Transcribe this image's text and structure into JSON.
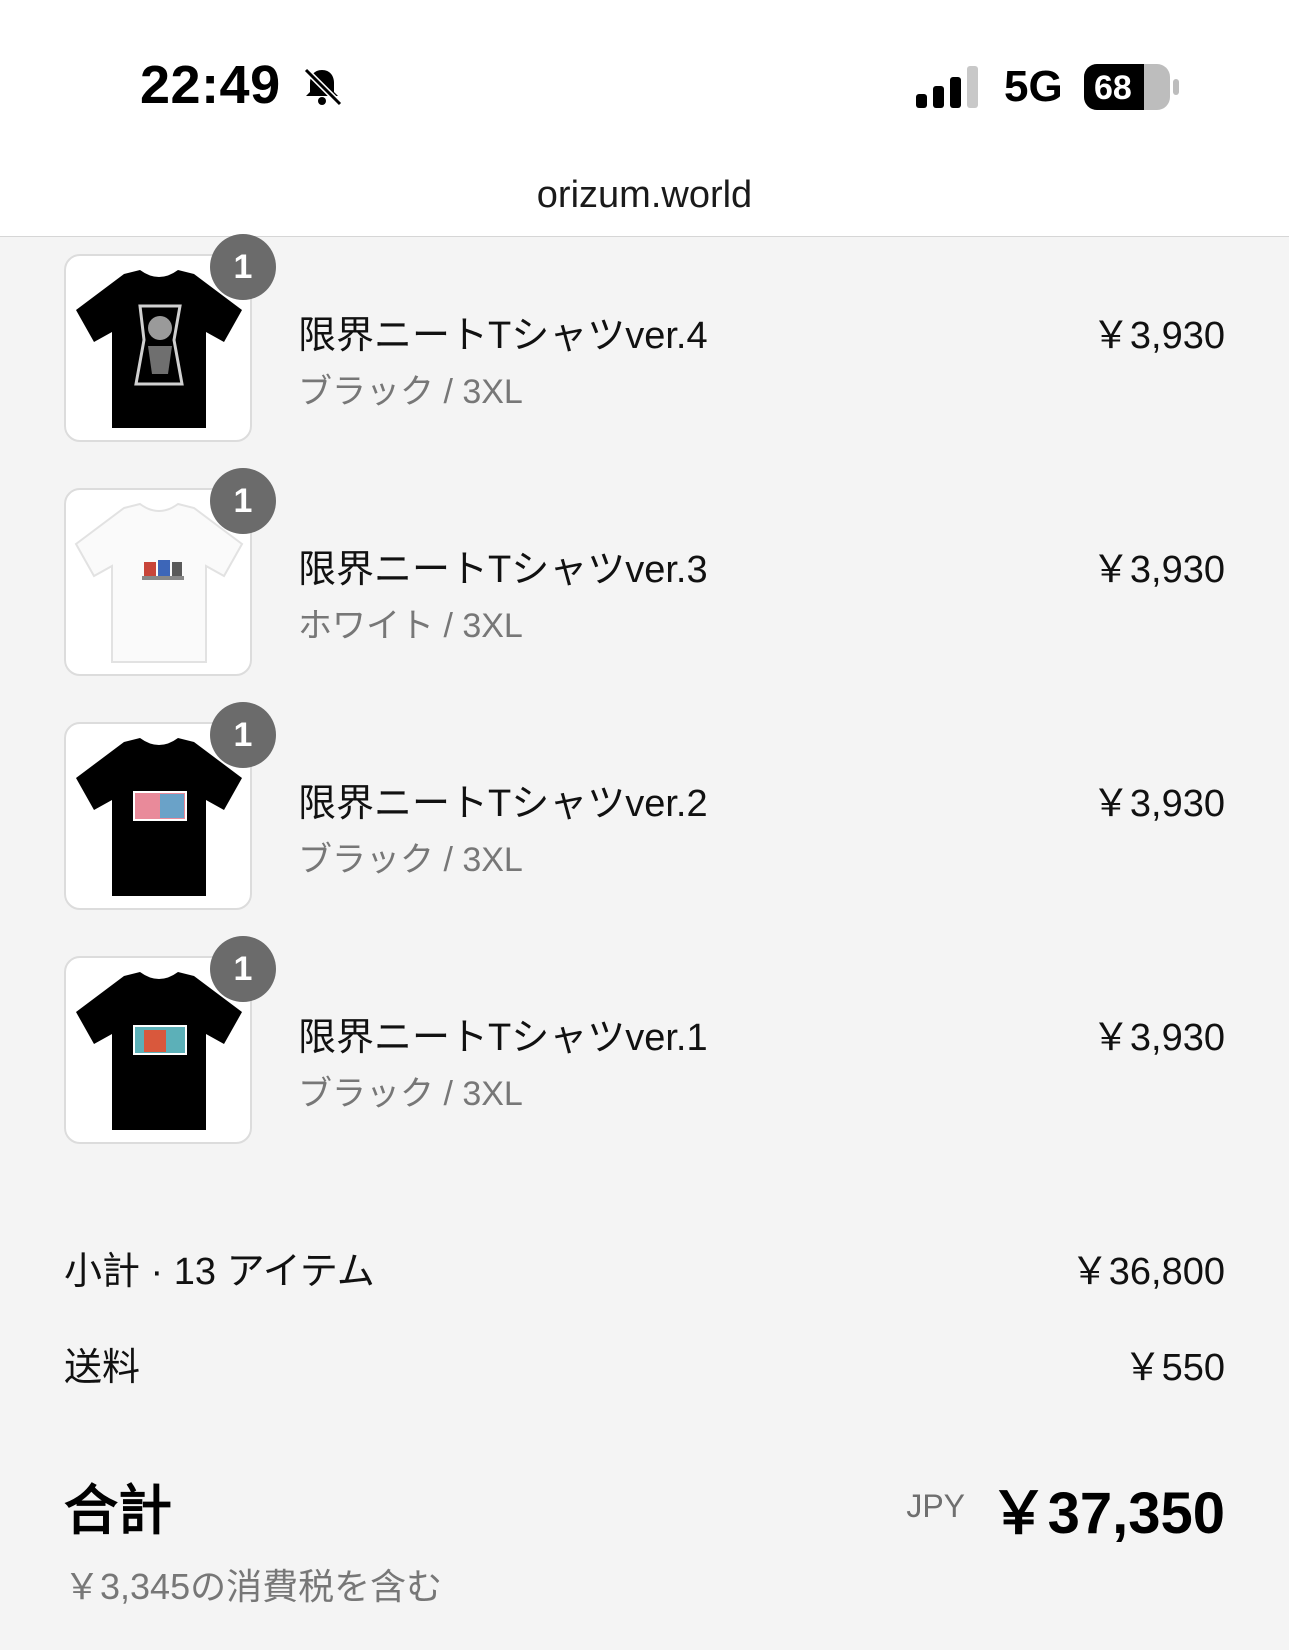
{
  "status_bar": {
    "time": "22:49",
    "network": "5G",
    "battery": "68",
    "silent_icon": "bell-slash-icon"
  },
  "browser": {
    "url": "orizum.world"
  },
  "cart": {
    "items": [
      {
        "name": "限界ニートTシャツver.4",
        "variant": "ブラック / 3XL",
        "price": "￥3,930",
        "quantity": "1",
        "shirt_color": "#000000"
      },
      {
        "name": "限界ニートTシャツver.3",
        "variant": "ホワイト / 3XL",
        "price": "￥3,930",
        "quantity": "1",
        "shirt_color": "#ffffff"
      },
      {
        "name": "限界ニートTシャツver.2",
        "variant": "ブラック / 3XL",
        "price": "￥3,930",
        "quantity": "1",
        "shirt_color": "#000000"
      },
      {
        "name": "限界ニートTシャツver.1",
        "variant": "ブラック / 3XL",
        "price": "￥3,930",
        "quantity": "1",
        "shirt_color": "#000000"
      }
    ]
  },
  "summary": {
    "subtotal_label": "小計 · 13 アイテム",
    "subtotal_value": "￥36,800",
    "shipping_label": "送料",
    "shipping_value": "￥550",
    "total_label": "合計",
    "currency": "JPY",
    "total_value": "￥37,350",
    "tax_note": "￥3,345の消費税を含む"
  }
}
